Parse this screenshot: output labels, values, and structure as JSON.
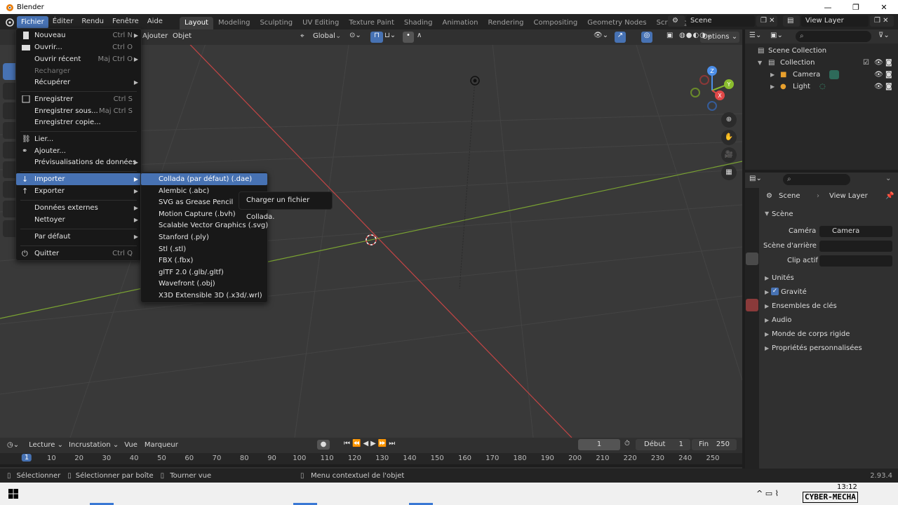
{
  "window": {
    "title": "Blender"
  },
  "topbar": {
    "menus": [
      "Fichier",
      "Éditer",
      "Rendu",
      "Fenêtre",
      "Aide"
    ],
    "workspaces": [
      "Layout",
      "Modeling",
      "Sculpting",
      "UV Editing",
      "Texture Paint",
      "Shading",
      "Animation",
      "Rendering",
      "Compositing",
      "Geometry Nodes",
      "Scripting"
    ],
    "active_workspace": "Layout",
    "scene_name": "Scene",
    "view_layer_name": "View Layer"
  },
  "viewport": {
    "header_items": [
      "Ajouter",
      "Objet"
    ],
    "orientation": "Global",
    "options_label": "Options",
    "gizmo_axes": [
      "Z",
      "Y",
      "X"
    ]
  },
  "file_menu": {
    "items": [
      {
        "label": "Nouveau",
        "shortcut": "Ctrl N",
        "arrow": true,
        "icon": "new-file-icon"
      },
      {
        "label": "Ouvrir...",
        "shortcut": "Ctrl O",
        "icon": "folder-icon"
      },
      {
        "label": "Ouvrir récent",
        "shortcut": "Maj Ctrl O",
        "arrow": true
      },
      {
        "label": "Recharger",
        "disabled": true
      },
      {
        "label": "Récupérer",
        "arrow": true
      },
      {
        "label": "Enregistrer",
        "shortcut": "Ctrl S",
        "icon": "save-icon"
      },
      {
        "label": "Enregistrer sous...",
        "shortcut": "Maj Ctrl S"
      },
      {
        "label": "Enregistrer copie..."
      },
      {
        "label": "Lier...",
        "icon": "link-icon"
      },
      {
        "label": "Ajouter...",
        "icon": "append-icon"
      },
      {
        "label": "Prévisualisations de données",
        "arrow": true
      },
      {
        "label": "Importer",
        "arrow": true,
        "icon": "import-icon",
        "highlighted": true
      },
      {
        "label": "Exporter",
        "arrow": true,
        "icon": "export-icon"
      },
      {
        "label": "Données externes",
        "arrow": true
      },
      {
        "label": "Nettoyer",
        "arrow": true
      },
      {
        "label": "Par défaut",
        "arrow": true
      },
      {
        "label": "Quitter",
        "shortcut": "Ctrl Q",
        "icon": "power-icon"
      }
    ]
  },
  "import_menu": {
    "items": [
      "Collada (par défaut) (.dae)",
      "Alembic (.abc)",
      "SVG as Grease Pencil",
      "Motion Capture (.bvh)",
      "Scalable Vector Graphics (.svg)",
      "Stanford (.ply)",
      "Stl (.stl)",
      "FBX (.fbx)",
      "glTF 2.0 (.glb/.gltf)",
      "Wavefront (.obj)",
      "X3D Extensible 3D (.x3d/.wrl)"
    ]
  },
  "tooltip": {
    "text": "Charger un fichier Collada."
  },
  "outliner": {
    "root": "Scene Collection",
    "collection": "Collection",
    "objects": [
      "Camera",
      "Light"
    ]
  },
  "properties": {
    "breadcrumb_scene": "Scene",
    "breadcrumb_layer": "View Layer",
    "panel_title": "Scène",
    "camera_label": "Caméra",
    "camera_value": "Camera",
    "background_label": "Scène d'arrière",
    "clip_label": "Clip actif",
    "sections": [
      "Unités",
      "Gravité",
      "Ensembles de clés",
      "Audio",
      "Monde de corps rigide",
      "Propriétés personnalisées"
    ]
  },
  "timeline": {
    "menus": [
      "Lecture",
      "Incrustation",
      "Vue",
      "Marqueur"
    ],
    "current_frame": "1",
    "start_label": "Début",
    "start": "1",
    "end_label": "Fin",
    "end": "250",
    "ruler": [
      "1",
      "10",
      "20",
      "30",
      "40",
      "50",
      "60",
      "70",
      "80",
      "90",
      "100",
      "110",
      "120",
      "130",
      "140",
      "150",
      "160",
      "170",
      "180",
      "190",
      "200",
      "210",
      "220",
      "230",
      "240",
      "250"
    ]
  },
  "statusbar": {
    "select": "Sélectionner",
    "box_select": "Sélectionner par boîte",
    "rotate": "Tourner vue",
    "context": "Menu contextuel de l'objet",
    "version": "2.93.4"
  },
  "taskbar": {
    "time": "13:12",
    "watermark": "CYBER-MECHA"
  },
  "colors": {
    "accent": "#4772b3",
    "x_axis": "#e14848",
    "y_axis": "#8bbd2e",
    "z_axis": "#4c8ee8"
  }
}
